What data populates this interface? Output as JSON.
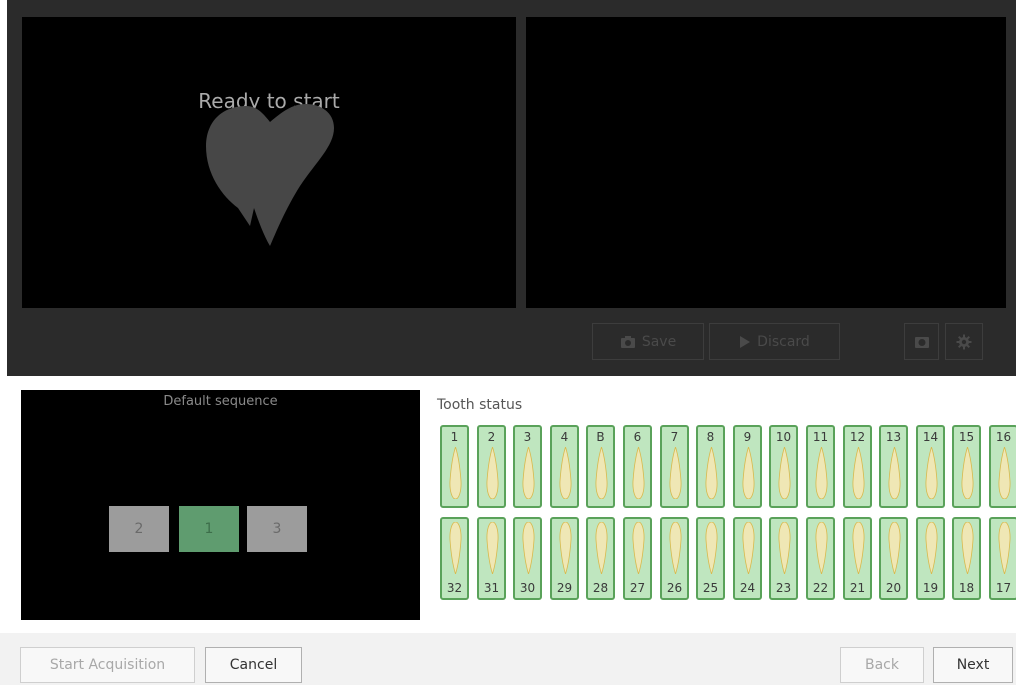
{
  "viewer": {
    "status_text": "Ready to start",
    "save_label": "Save",
    "discard_label": "Discard"
  },
  "toolbar_icons": [
    "camera-icon",
    "play-icon",
    "snapshot-icon",
    "gear-icon"
  ],
  "sequence": {
    "title": "Default sequence",
    "boxes": [
      {
        "label": "2",
        "state": "inactive"
      },
      {
        "label": "1",
        "state": "active"
      },
      {
        "label": "3",
        "state": "inactive"
      }
    ]
  },
  "tooth_status": {
    "label": "Tooth status",
    "upper": [
      "1",
      "2",
      "3",
      "4",
      "B",
      "6",
      "7",
      "8",
      "9",
      "10",
      "11",
      "12",
      "13",
      "14",
      "15",
      "16"
    ],
    "lower": [
      "32",
      "31",
      "30",
      "29",
      "28",
      "27",
      "26",
      "25",
      "24",
      "23",
      "22",
      "21",
      "20",
      "19",
      "18",
      "17"
    ]
  },
  "footer": {
    "start_acquisition": "Start Acquisition",
    "cancel": "Cancel",
    "back": "Back",
    "next": "Next"
  },
  "colors": {
    "dark_panel": "#2b2b2b",
    "tooth_bg": "#bfe6bf",
    "tooth_border": "#5aa25a",
    "seq_active": "#5f9c6f",
    "seq_inactive": "#9c9c9c"
  }
}
